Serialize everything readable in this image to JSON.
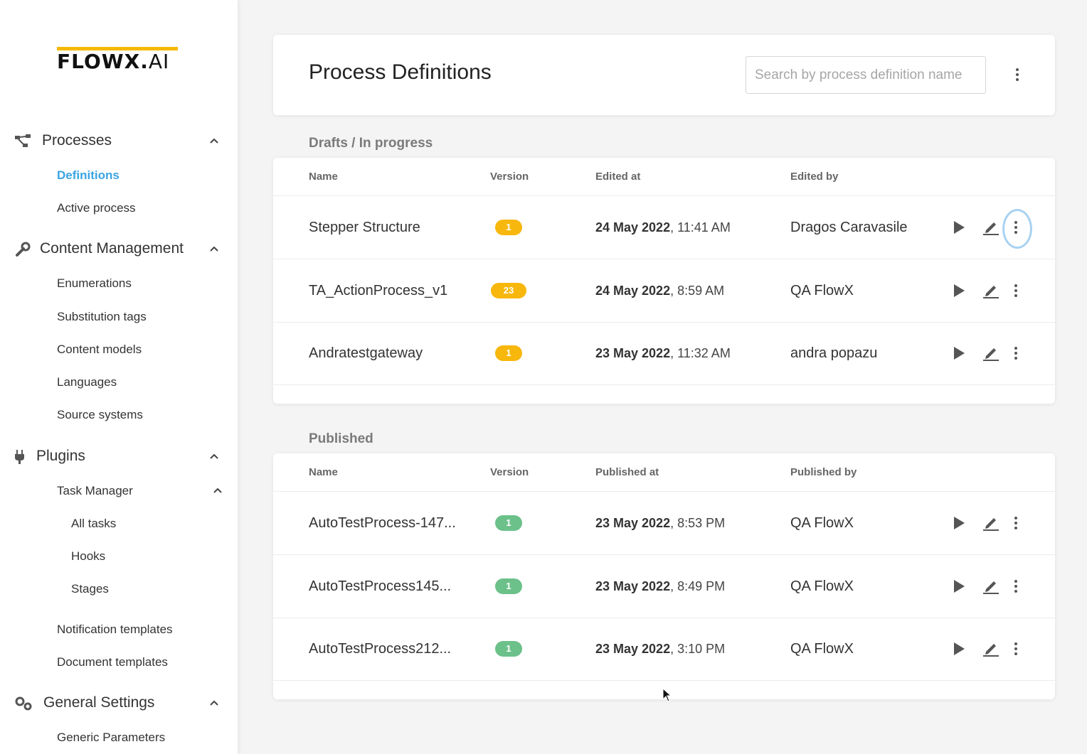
{
  "app": {
    "logo_bold": "FLOWX.",
    "logo_light": "AI"
  },
  "sidebar": {
    "sections": [
      {
        "label": "Processes",
        "icon": "process-tree-icon",
        "items": [
          "Definitions",
          "Active process"
        ]
      },
      {
        "label": "Content Management",
        "icon": "wrench-icon",
        "items": [
          "Enumerations",
          "Substitution tags",
          "Content models",
          "Languages",
          "Source systems"
        ]
      },
      {
        "label": "Plugins",
        "icon": "plug-icon",
        "items": [
          "Task Manager",
          "Notification templates",
          "Document templates"
        ],
        "subitems": [
          "All tasks",
          "Hooks",
          "Stages"
        ]
      },
      {
        "label": "General Settings",
        "icon": "gears-icon",
        "items": [
          "Generic Parameters"
        ]
      }
    ],
    "active_item": "Definitions"
  },
  "header": {
    "title": "Process Definitions",
    "search_placeholder": "Search by process definition name"
  },
  "drafts": {
    "title": "Drafts / In progress",
    "columns": [
      "Name",
      "Version",
      "Edited at",
      "Edited by"
    ],
    "rows": [
      {
        "name": "Stepper Structure",
        "version": "1",
        "date": "24 May 2022",
        "time": ", 11:41 AM",
        "user": "Dragos Caravasile"
      },
      {
        "name": "TA_ActionProcess_v1",
        "version": "23",
        "date": "24 May 2022",
        "time": ", 8:59 AM",
        "user": "QA FlowX"
      },
      {
        "name": "Andratestgateway",
        "version": "1",
        "date": "23 May 2022",
        "time": ", 11:32 AM",
        "user": "andra popazu"
      }
    ]
  },
  "published": {
    "title": "Published",
    "columns": [
      "Name",
      "Version",
      "Published at",
      "Published by"
    ],
    "rows": [
      {
        "name": "AutoTestProcess-147...",
        "version": "1",
        "date": "23 May 2022",
        "time": ", 8:53 PM",
        "user": "QA FlowX"
      },
      {
        "name": "AutoTestProcess145...",
        "version": "1",
        "date": "23 May 2022",
        "time": ", 8:49 PM",
        "user": "QA FlowX"
      },
      {
        "name": "AutoTestProcess212...",
        "version": "1",
        "date": "23 May 2022",
        "time": ", 3:10 PM",
        "user": "QA FlowX"
      }
    ]
  },
  "colors": {
    "accent": "#3ba4e2",
    "logo_bar": "#f5b800",
    "draft_badge": "#f7b70c",
    "published_badge": "#6cc18a"
  }
}
